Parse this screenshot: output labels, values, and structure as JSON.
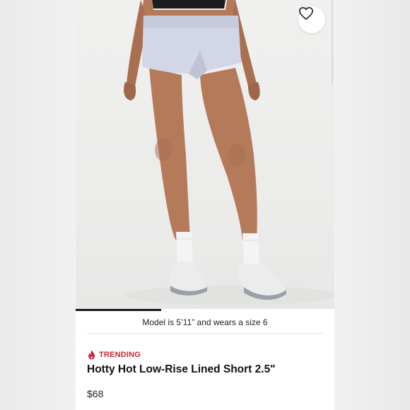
{
  "product": {
    "model_note": "Model is 5’11” and wears a size 6",
    "badge": "TRENDING",
    "title": "Hotty Hot Low-Rise Lined Short 2.5\"",
    "price": "$68"
  },
  "gallery": {
    "progress": 0.33
  },
  "icons": {
    "favorite": "heart-outline-icon",
    "trending": "flame-icon"
  },
  "colors": {
    "accent": "#d22030",
    "text": "#111111",
    "background": "#ffffff"
  }
}
